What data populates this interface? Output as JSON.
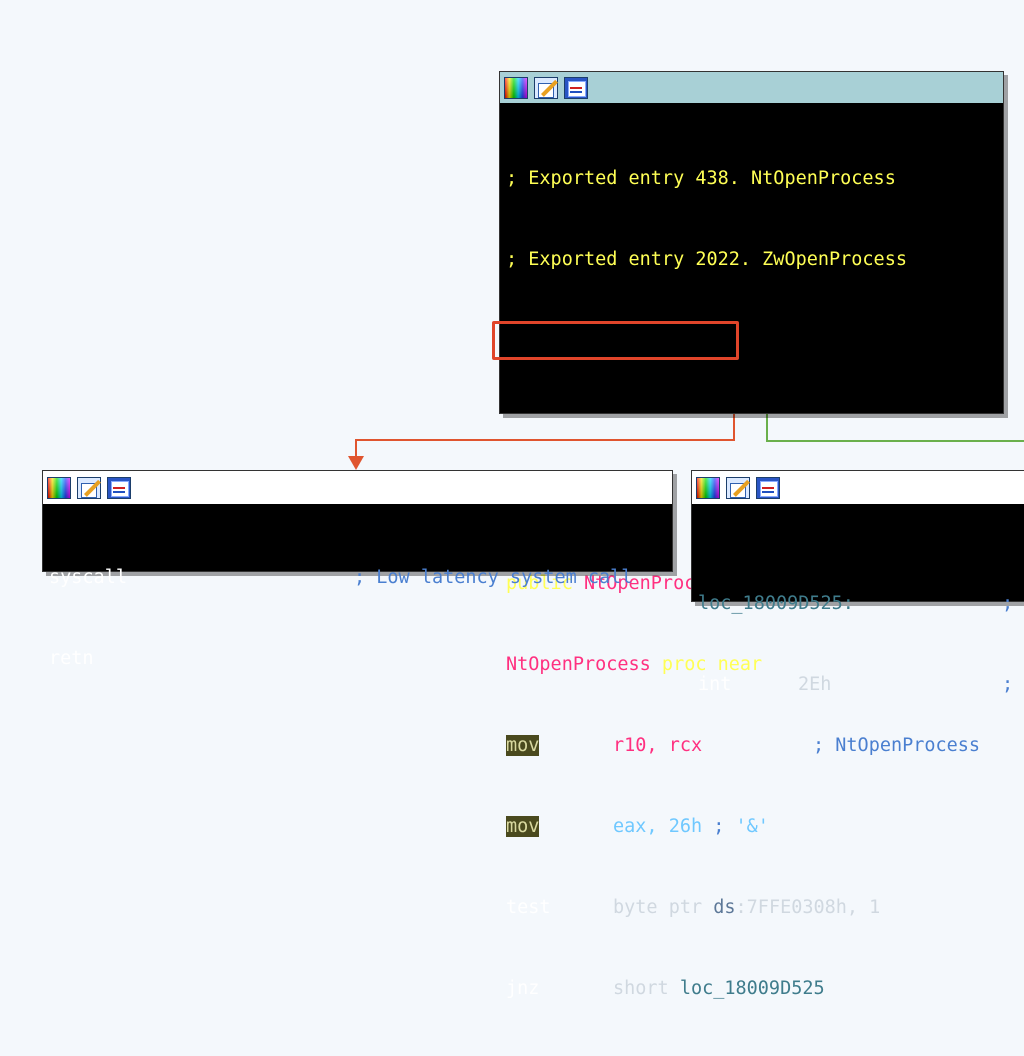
{
  "main_node": {
    "lines": {
      "l1": "; Exported entry 438. NtOpenProcess",
      "l2": "; Exported entry 2022. ZwOpenProcess",
      "public_kw": "public",
      "public_name": "NtOpenProcess",
      "proc_name": "NtOpenProcess",
      "proc_rest": " proc near",
      "mov1": "mov",
      "mov1_ops": "r10, rcx",
      "mov1_cmt": "; NtOpenProcess",
      "mov2": "mov",
      "mov2_ops": "eax, 26h",
      "mov2_cmt": ";",
      "mov2_char": "'&'",
      "test": "test",
      "test_ops_a": "byte ptr ",
      "test_seg": "ds",
      "test_ops_b": ":7FFE0308h, 1",
      "jnz": "jnz",
      "jnz_ops_a": "short ",
      "jnz_target": "loc_18009D525"
    }
  },
  "left_node": {
    "syscall": "syscall",
    "syscall_cmt": "; Low latency system call",
    "retn": "retn"
  },
  "right_node": {
    "label": "loc_18009D525:",
    "label_cmt": ";",
    "int": "int",
    "int_ops": "2Eh",
    "int_cmt": ";"
  },
  "icons": {
    "color": "color-palette-icon",
    "rename": "rename-pencil-icon",
    "graph": "graph-view-icon"
  },
  "colors": {
    "edge_false": "#e0552f",
    "edge_true": "#6ab04c",
    "highlight": "#e0452a"
  }
}
